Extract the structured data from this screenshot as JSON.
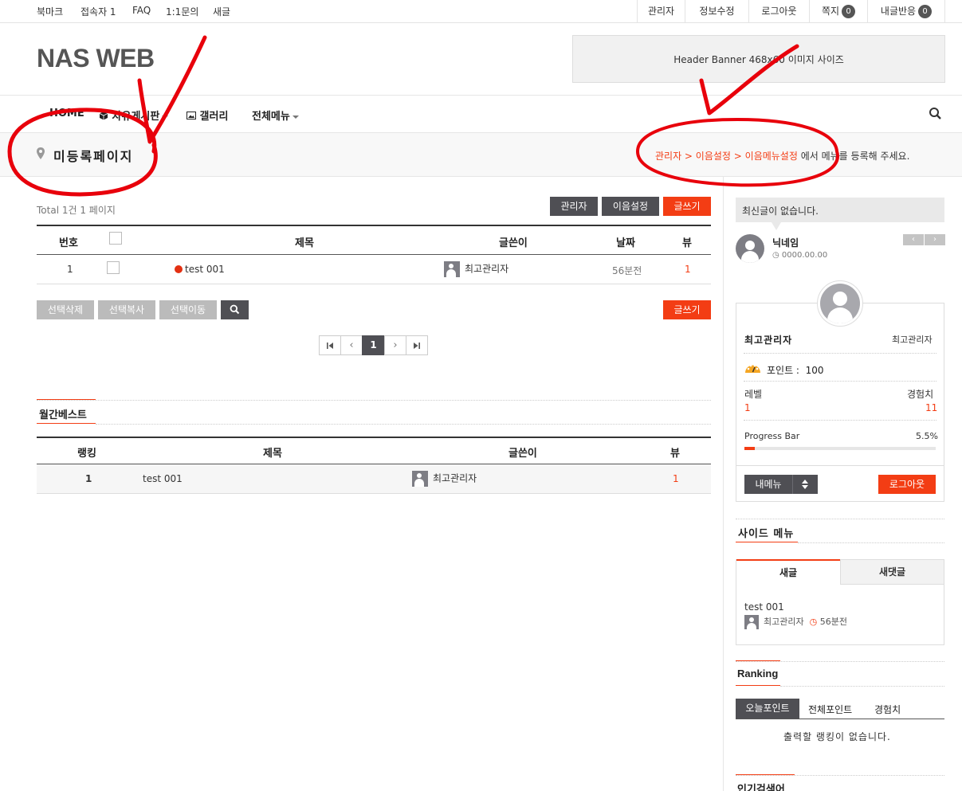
{
  "topbar": {
    "left_links": [
      "북마크",
      "접속자 1",
      "FAQ",
      "1:1문의",
      "새글"
    ],
    "right_links": {
      "admin": "관리자",
      "edit_info": "정보수정",
      "logout": "로그아웃",
      "memo": "쪽지",
      "memo_count": "0",
      "replies": "내글반응",
      "replies_count": "0"
    }
  },
  "header": {
    "logo": "NAS WEB",
    "banner": "Header Banner 468x60 이미지 사이즈"
  },
  "nav": {
    "items": [
      "HOME",
      "자유게시판",
      "갤러리",
      "전체메뉴"
    ]
  },
  "page_title": {
    "title": "미등록페이지",
    "hint_link": "관리자 > 이음설정 > 이음메뉴설정",
    "hint_text": " 에서 메뉴를 등록해 주세요."
  },
  "board": {
    "total": "Total 1건 1 페이지",
    "buttons": {
      "admin": "관리자",
      "settings": "이음설정",
      "write": "글쓰기"
    },
    "columns": {
      "num": "번호",
      "title": "제목",
      "author": "글쓴이",
      "date": "날짜",
      "views": "뷰"
    },
    "rows": [
      {
        "num": "1",
        "title": "test 001",
        "author": "최고관리자",
        "date": "56분전",
        "views": "1"
      }
    ],
    "actions": {
      "delete": "선택삭제",
      "copy": "선택복사",
      "move": "선택이동",
      "write": "글쓰기"
    },
    "pagination": {
      "current": "1"
    }
  },
  "monthly_best": {
    "title": "월간베스트",
    "columns": {
      "rank": "랭킹",
      "title": "제목",
      "author": "글쓴이",
      "views": "뷰"
    },
    "rows": [
      {
        "rank": "1",
        "title": "test 001",
        "author": "최고관리자",
        "views": "1"
      }
    ]
  },
  "sidebar": {
    "latest_notice": "최신글이 없습니다.",
    "nickname": "닉네임",
    "date": "0000.00.00",
    "profile": {
      "name": "최고관리자",
      "role": "최고관리자",
      "points_label": "포인트 :",
      "points": "100",
      "level_label": "레벨",
      "level": "1",
      "exp_label": "경험치",
      "exp": "11",
      "progress_label": "Progress Bar",
      "progress_text": "5.5%",
      "progress": 0.055,
      "my_menu": "내메뉴",
      "logout": "로그아웃"
    },
    "side_menu_title": "사이드 메뉴",
    "tabs": {
      "new_posts": "새글",
      "new_comments": "새댓글"
    },
    "new_post": {
      "title": "test 001",
      "author": "최고관리자",
      "time": "56분전"
    },
    "ranking": {
      "title": "Ranking",
      "tabs": [
        "오늘포인트",
        "전체포인트",
        "경험치"
      ],
      "empty": "출력할 랭킹이 없습니다."
    },
    "popular_search_title": "인기검색어"
  },
  "colors": {
    "accent": "#f33d14",
    "dark": "#4f4f54",
    "annotation": "#e8000b"
  }
}
